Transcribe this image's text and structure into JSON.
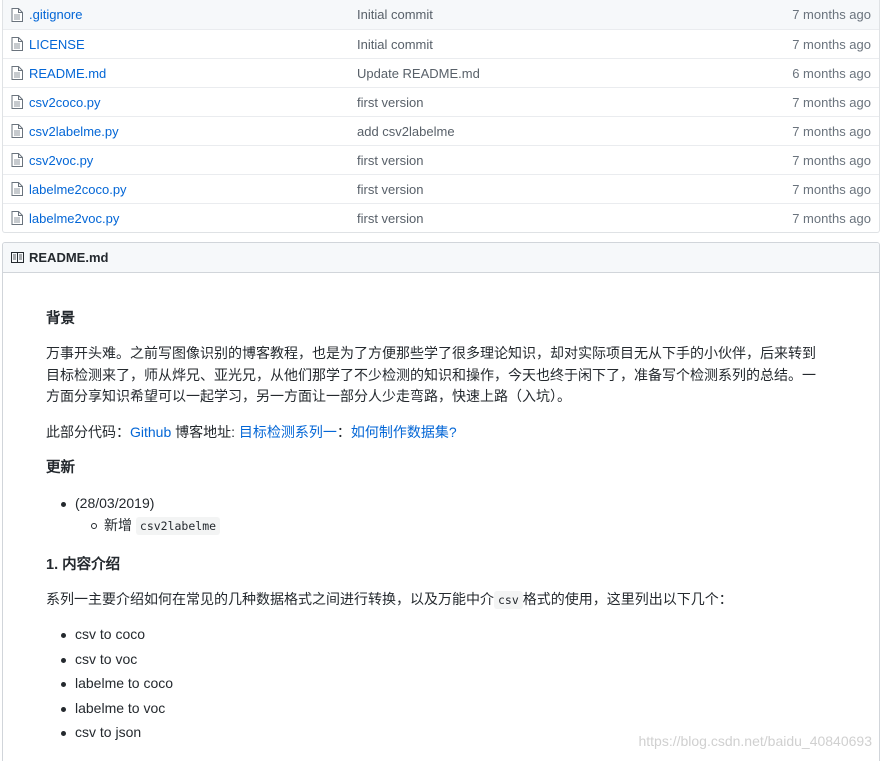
{
  "files": [
    {
      "name": ".gitignore",
      "message": "Initial commit",
      "age": "7 months ago"
    },
    {
      "name": "LICENSE",
      "message": "Initial commit",
      "age": "7 months ago"
    },
    {
      "name": "README.md",
      "message": "Update README.md",
      "age": "6 months ago"
    },
    {
      "name": "csv2coco.py",
      "message": "first version",
      "age": "7 months ago"
    },
    {
      "name": "csv2labelme.py",
      "message": "add csv2labelme",
      "age": "7 months ago"
    },
    {
      "name": "csv2voc.py",
      "message": "first version",
      "age": "7 months ago"
    },
    {
      "name": "labelme2coco.py",
      "message": "first version",
      "age": "7 months ago"
    },
    {
      "name": "labelme2voc.py",
      "message": "first version",
      "age": "7 months ago"
    }
  ],
  "readme": {
    "header": "README.md",
    "bg_heading": "背景",
    "bg_line1": "万事开头难。之前写图像识别的博客教程，也是为了方便那些学了很多理论知识，却对实际项目无从下手的小伙伴，后来转到",
    "bg_line2": "目标检测来了，师从烨兄、亚光兄，从他们那学了不少检测的知识和操作，今天也终于闲下了，准备写个检测系列的总结。一",
    "bg_line3": "方面分享知识希望可以一起学习，另一方面让一部分人少走弯路，快速上路（入坑）。",
    "code_prefix": "此部分代码：",
    "code_link": "Github",
    "blog_prefix": " 博客地址: ",
    "blog_link1": "目标检测系列一",
    "blog_sep": "：",
    "blog_link2": "如何制作数据集?",
    "update_heading": "更新",
    "update_date": "(28/03/2019)",
    "update_item_prefix": "新增 ",
    "update_item_code": "csv2labelme",
    "intro_heading": "1. 内容介绍",
    "intro_prefix": "系列一主要介绍如何在常见的几种数据格式之间进行转换，以及万能中介",
    "intro_code": "csv",
    "intro_suffix": "格式的使用，这里列出以下几个：",
    "conversions": [
      "csv to coco",
      "csv to voc",
      "labelme to coco",
      "labelme to voc",
      "csv to json"
    ]
  },
  "watermark": "https://blog.csdn.net/baidu_40840693",
  "colors": {
    "link": "#0366d6",
    "text": "#24292e",
    "muted": "#586069",
    "border": "#d1d5da"
  }
}
